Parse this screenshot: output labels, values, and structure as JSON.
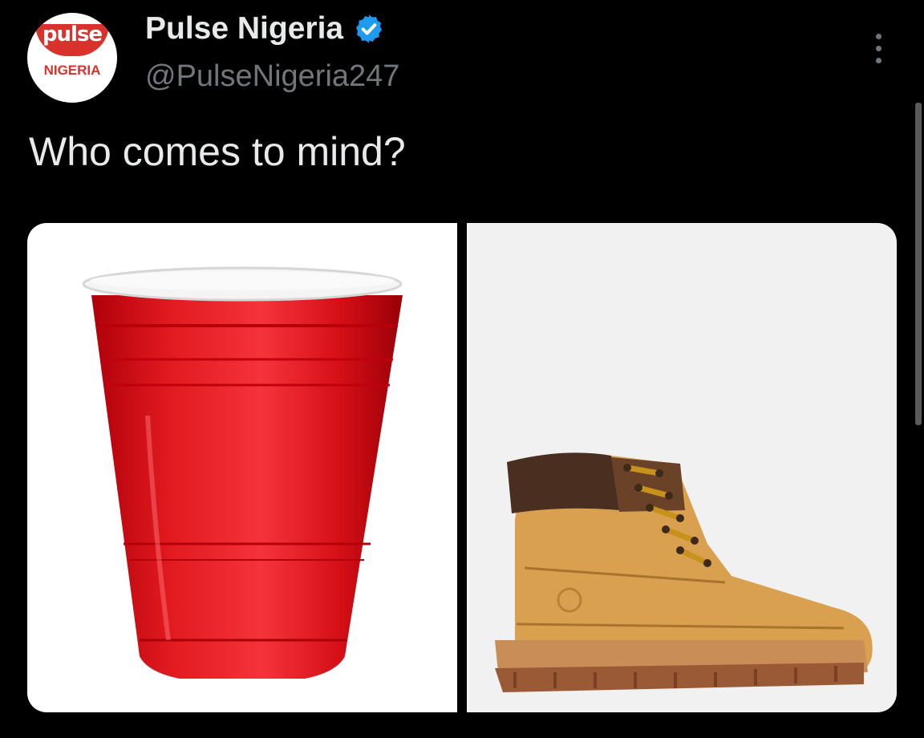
{
  "account": {
    "display_name": "Pulse Nigeria",
    "handle": "@PulseNigeria247",
    "verified": true,
    "avatar_logo_top": "pulse",
    "avatar_logo_bottom": "NIGERIA"
  },
  "tweet": {
    "text": "Who comes to mind?"
  },
  "media": [
    {
      "icon": "red-party-cup"
    },
    {
      "icon": "timberland-boot"
    }
  ],
  "colors": {
    "background": "#000000",
    "primary_text": "#e7e9ea",
    "secondary_text": "#71767b",
    "verified_badge": "#1d9bf0",
    "brand_red": "#d9312b"
  }
}
